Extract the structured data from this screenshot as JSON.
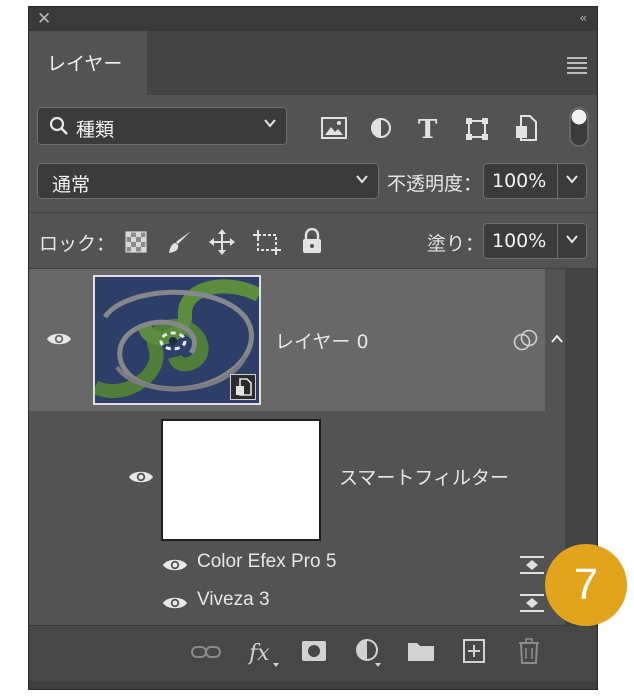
{
  "panel": {
    "close_glyph": "✕",
    "collapse_glyph": "‹‹",
    "tab_label": "レイヤー"
  },
  "filter_bar": {
    "kind_label": "種類"
  },
  "blend_bar": {
    "mode": "通常",
    "opacity_label": "不透明度：",
    "opacity_value": "100%"
  },
  "lock_bar": {
    "lock_label": "ロック：",
    "fill_label": "塗り：",
    "fill_value": "100%"
  },
  "layers": {
    "layer_name": "レイヤー 0",
    "smart_filters_label": "スマートフィルター",
    "filters": [
      {
        "name": "Color Efex Pro 5"
      },
      {
        "name": "Viveza 3"
      }
    ]
  },
  "step_badge": "7",
  "colors": {
    "panel_bg": "#535353",
    "selected_layer": "#686868",
    "badge": "#e2a41c"
  }
}
